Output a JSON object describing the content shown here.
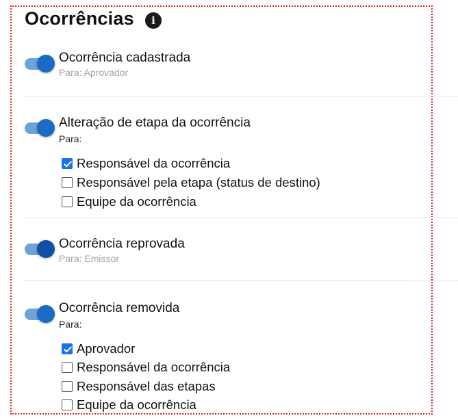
{
  "header": {
    "title": "Ocorrências",
    "info_icon_glyph": "i",
    "info_icon": "info-circle-icon"
  },
  "notifications": [
    {
      "label": "Ocorrência cadastrada",
      "subtitle": "Para: Aprovador",
      "enabled": true
    },
    {
      "label": "Alteração de etapa da ocorrência",
      "subtitle": "Para:",
      "enabled": true,
      "options": [
        {
          "label": "Responsável da ocorrência",
          "checked": true
        },
        {
          "label": "Responsável pela etapa (status de destino)",
          "checked": false
        },
        {
          "label": "Equipe da ocorrência",
          "checked": false
        }
      ]
    },
    {
      "label": "Ocorrência reprovada",
      "subtitle": "Para: Emissor",
      "enabled": true
    },
    {
      "label": "Ocorrência removida",
      "subtitle": "Para:",
      "enabled": true,
      "options": [
        {
          "label": "Aprovador",
          "checked": true
        },
        {
          "label": "Responsável da ocorrência",
          "checked": false
        },
        {
          "label": "Responsável das etapas",
          "checked": false
        },
        {
          "label": "Equipe da ocorrência",
          "checked": false
        }
      ]
    }
  ],
  "colors": {
    "frame_border": "#e02020",
    "toggle_track": "#6fa2d8",
    "toggle_knob": "#1a6bc4",
    "checkbox_checked": "#1a73e8"
  }
}
